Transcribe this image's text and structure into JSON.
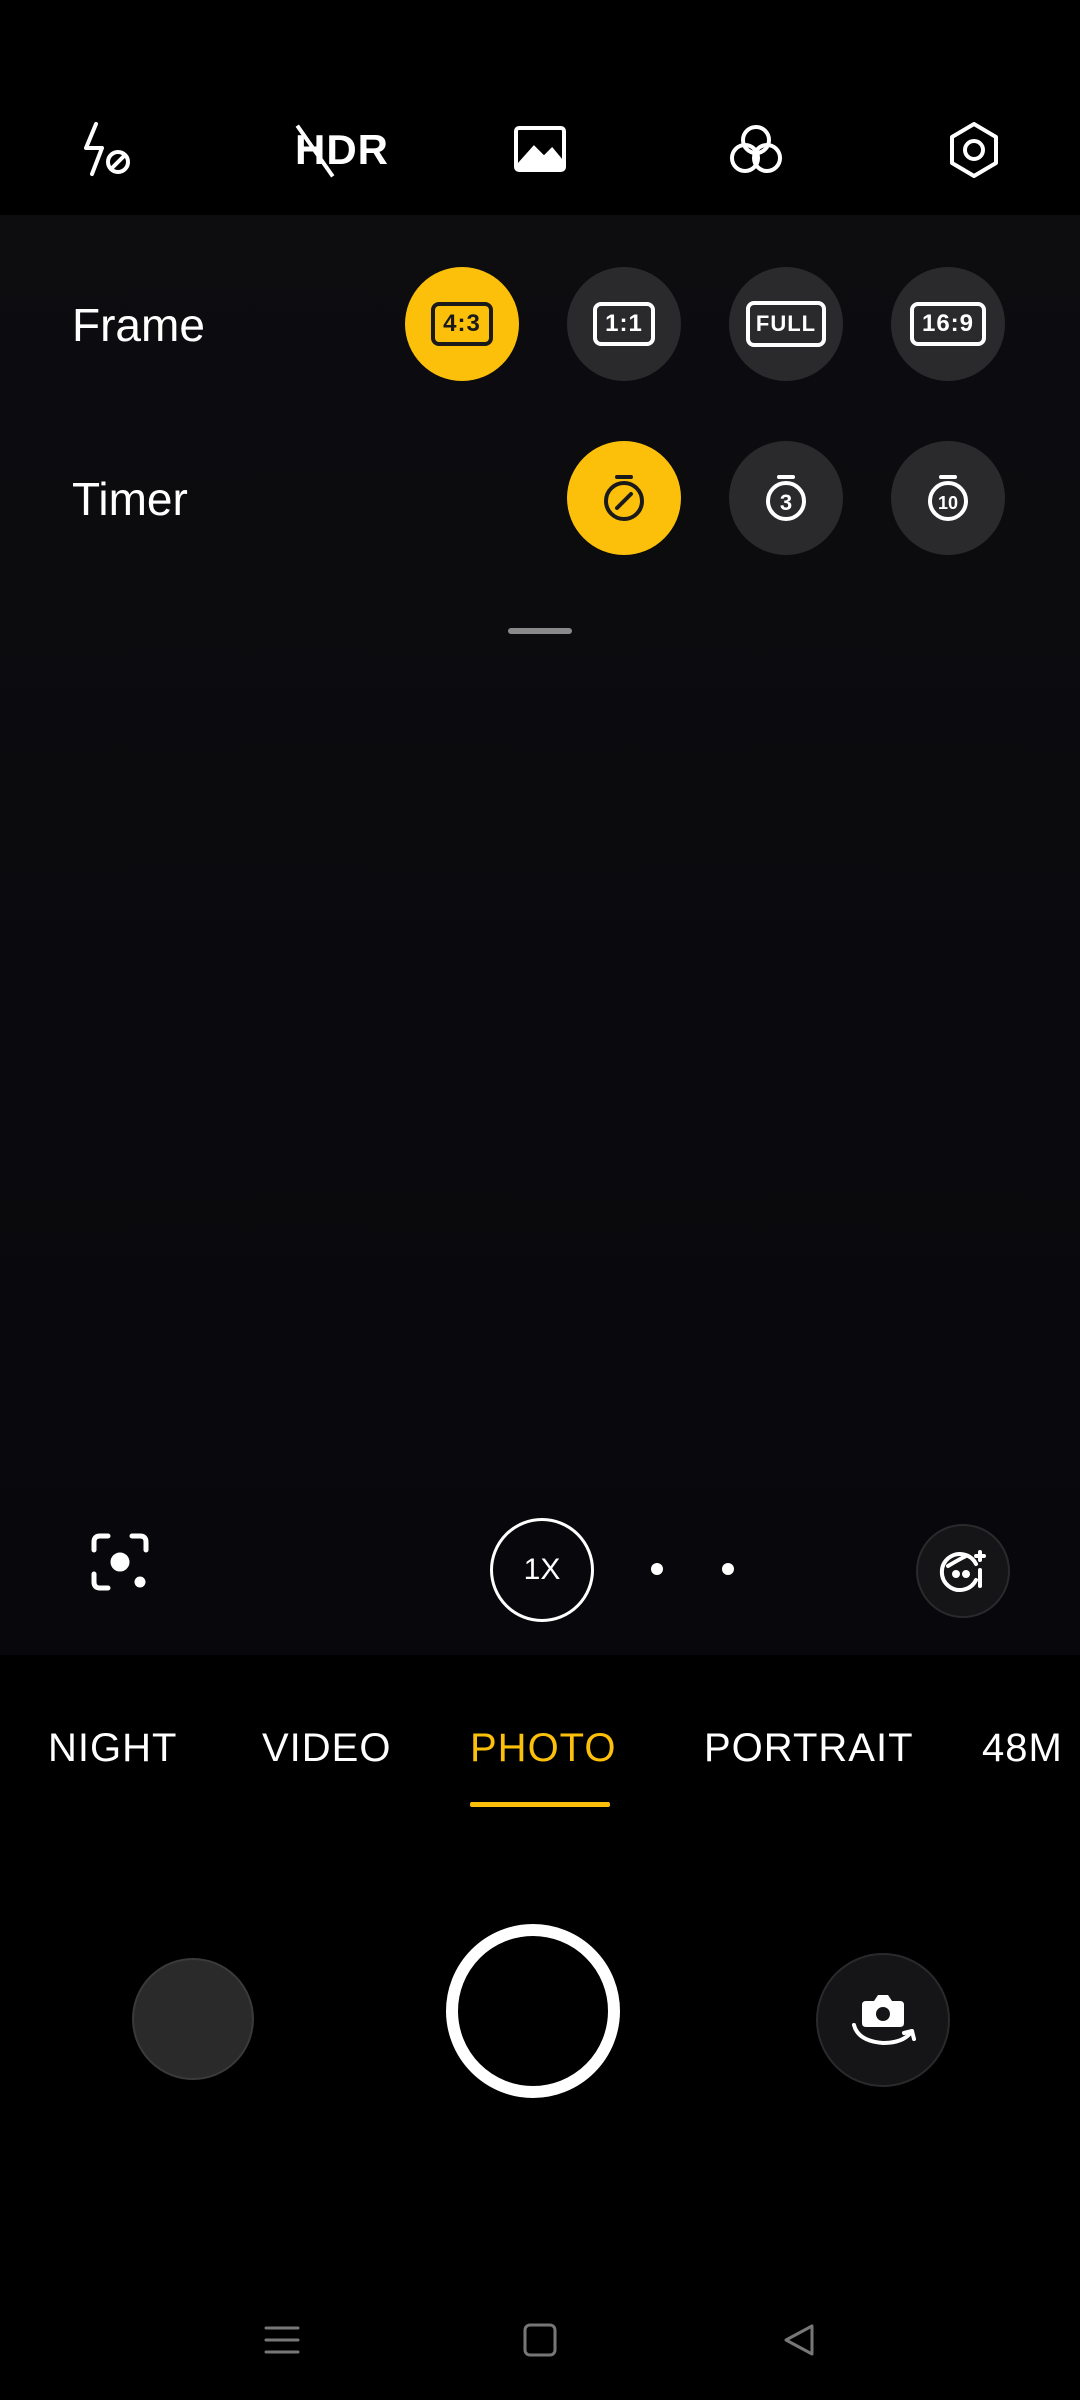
{
  "top_bar": {
    "flash_icon": "flash-off-icon",
    "hdr_label": "HDR",
    "gallery_icon": "image-icon",
    "filter_icon": "filter-icon",
    "settings_icon": "settings-icon"
  },
  "frame_row": {
    "label": "Frame",
    "options": [
      "4:3",
      "1:1",
      "FULL",
      "16:9"
    ],
    "selected": "4:3"
  },
  "timer_row": {
    "label": "Timer",
    "options": [
      "off",
      "3",
      "10"
    ],
    "selected": "off"
  },
  "viewfinder": {
    "zoom_label": "1X",
    "focus_icon": "focus-icon",
    "beauty_icon": "face-beauty-icon"
  },
  "modes": {
    "items": [
      "NIGHT",
      "VIDEO",
      "PHOTO",
      "PORTRAIT",
      "48M"
    ],
    "active": "PHOTO"
  },
  "controls": {
    "gallery_thumb": "gallery-thumbnail",
    "shutter": "shutter-button",
    "switch_camera_icon": "switch-camera-icon"
  },
  "nav_bar": {
    "menu_icon": "menu-icon",
    "home_icon": "home-icon",
    "back_icon": "back-icon"
  },
  "colors": {
    "accent": "#fcbf0a",
    "button_bg": "#2a2a2c",
    "background": "#000000"
  }
}
